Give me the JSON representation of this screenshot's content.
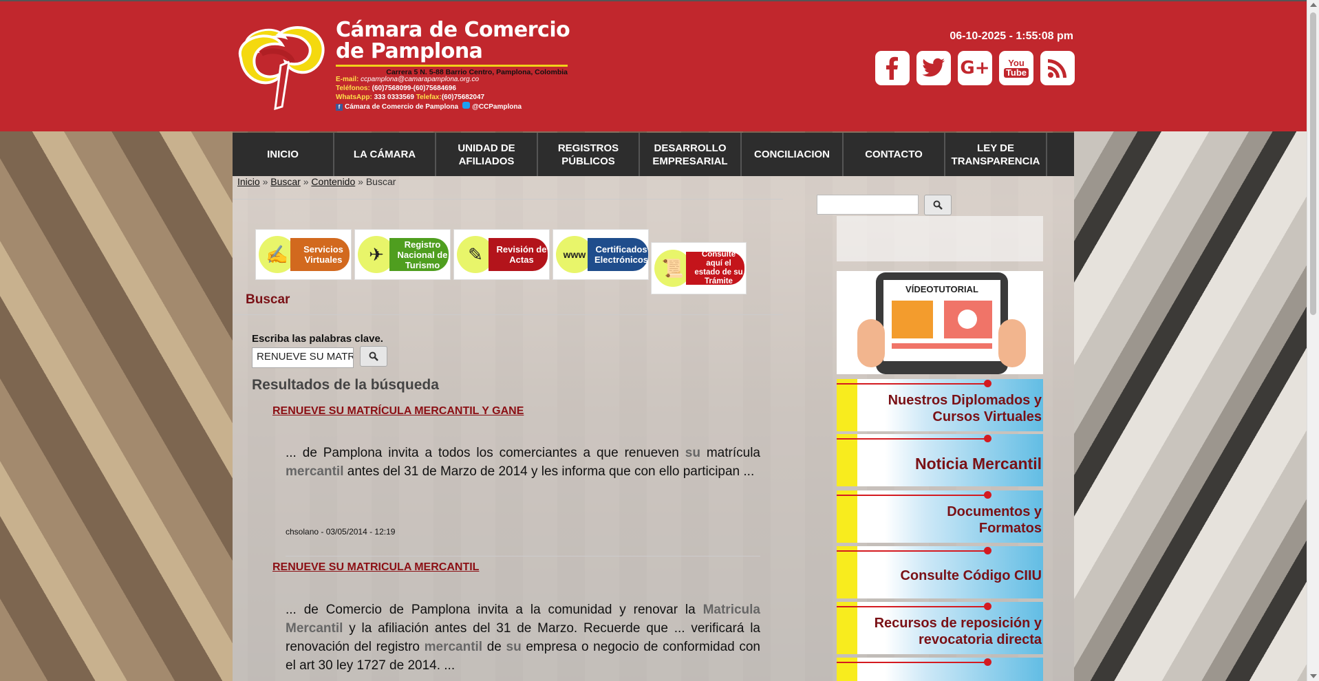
{
  "header": {
    "logo": {
      "title_line1": "Cámara de Comercio",
      "title_line2": "de Pamplona",
      "address": "Carrera 5 N. 5-88 Barrio Centro, Pamplona, Colombia",
      "email_label": "E-mail:",
      "email": "ccpamplona@camarapamplona.org.co",
      "phones_label": "Teléfonos:",
      "phones": "(60)7568099-(60)75684696",
      "whatsapp_label": "WhatsApp:",
      "whatsapp": "333 0333569",
      "fax_label": "Telefax:",
      "fax": "(60)75682047",
      "facebook": "Cámara de Comercio de Pamplona",
      "twitter": "@CCPamplona"
    },
    "datetime": "06-10-2025 - 1:55:08 pm",
    "social": [
      {
        "icon": "facebook-icon",
        "glyph": "f"
      },
      {
        "icon": "twitter-icon",
        "glyph": "t"
      },
      {
        "icon": "google-plus-icon",
        "glyph": "G+"
      },
      {
        "icon": "youtube-icon",
        "glyph": "You Tube"
      },
      {
        "icon": "rss-icon",
        "glyph": ""
      }
    ],
    "accent_color": "#c1272d"
  },
  "nav": {
    "items": [
      {
        "label": "INICIO"
      },
      {
        "label": "LA CÁMARA"
      },
      {
        "label": "UNIDAD DE AFILIADOS"
      },
      {
        "label": "REGISTROS PÚBLICOS"
      },
      {
        "label": "DESARROLLO EMPRESARIAL"
      },
      {
        "label": "CONCILIACION"
      },
      {
        "label": "CONTACTO"
      },
      {
        "label": "LEY DE TRANSPARENCIA"
      }
    ]
  },
  "breadcrumb": {
    "items": [
      "Inicio",
      "Buscar",
      "Contenido"
    ],
    "current": "Buscar",
    "separator": "»"
  },
  "service_buttons": [
    {
      "label": "Servicios Virtuales",
      "color": "#d2691e",
      "icon": "user-pen-icon"
    },
    {
      "label": "Registro Nacional de Turismo",
      "color": "#4f9e1f",
      "icon": "airplane-icon"
    },
    {
      "label": "Revisión de Actas",
      "color": "#b3141b",
      "icon": "document-pen-icon"
    },
    {
      "label": "Certificados Electrónicos",
      "color": "#1f4d8c",
      "icon": "www-globe-icon"
    },
    {
      "label": "Consulte aquí el estado de su Trámite",
      "color": "#c4141b",
      "icon": "scroll-icon"
    }
  ],
  "search": {
    "page_title": "Buscar",
    "keyword_label": "Escriba las palabras clave.",
    "keyword_value": "RENUEVE SU MATRÍCULA MERCANTIL Y GANE",
    "results_heading": "Resultados de la búsqueda"
  },
  "results": [
    {
      "title": "RENUEVE SU MATRÍCULA MERCANTIL Y GANE",
      "snippet_parts": [
        {
          "t": "... de Pamplona invita a todos los comerciantes a que renueven "
        },
        {
          "t": "su",
          "b": true
        },
        {
          "t": " matrícula "
        },
        {
          "t": "mercantil",
          "b": true
        },
        {
          "t": " antes del 31 de Marzo de 2014 y les informa que con ello participan ..."
        }
      ],
      "meta": "chsolano - 03/05/2014 - 12:19"
    },
    {
      "title": "RENUEVE SU MATRICULA MERCANTIL",
      "snippet_parts": [
        {
          "t": "... de Comercio de Pamplona invita a la comunidad y renovar la "
        },
        {
          "t": "Matricula Mercantil",
          "b": true
        },
        {
          "t": " y la afiliación antes del 31 de Marzo. Recuerde que ... verificará la renovación del registro "
        },
        {
          "t": "mercantil",
          "b": true
        },
        {
          "t": " de "
        },
        {
          "t": "su",
          "b": true
        },
        {
          "t": " empresa o negocio de conformidad con el art 30 ley 1727 de 2014. ..."
        }
      ]
    }
  ],
  "sidebar": {
    "video_title": "VÍDEOTUTORIAL",
    "banners": [
      {
        "label": "Nuestros Diplomados y Cursos Virtuales"
      },
      {
        "label": "Noticia Mercantil"
      },
      {
        "label": "Documentos y Formatos"
      },
      {
        "label": "Consulte Código CIIU"
      },
      {
        "label": "Recursos de reposición y revocatoria directa"
      }
    ]
  }
}
